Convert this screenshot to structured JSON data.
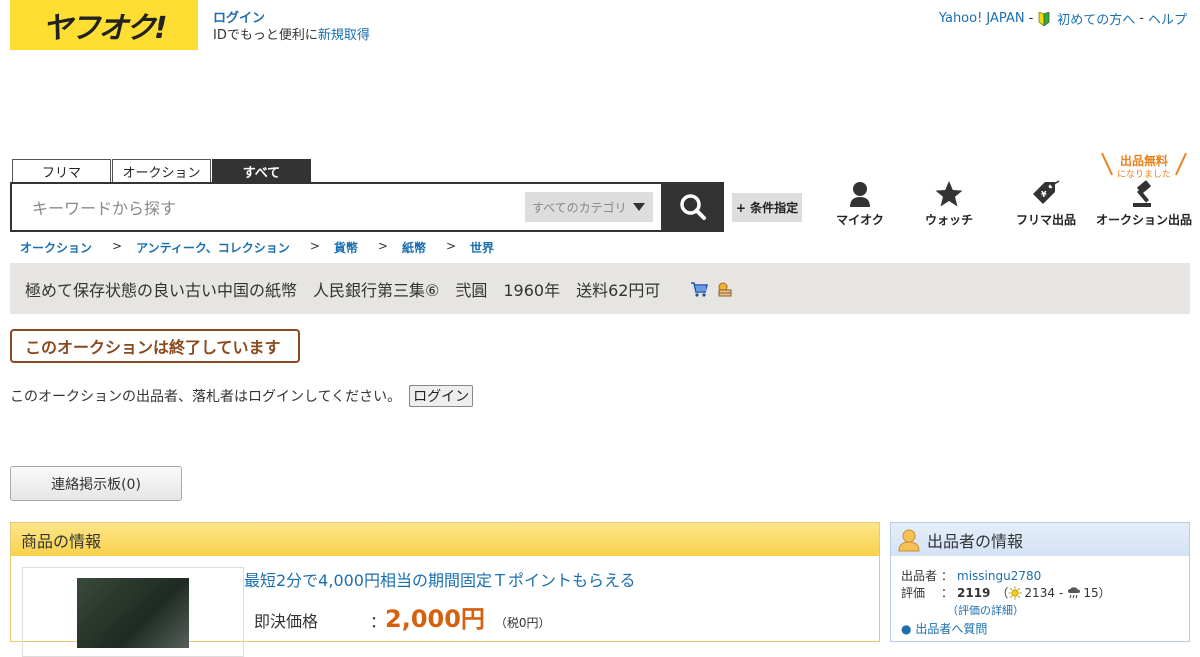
{
  "header": {
    "logo_text": "ヤフオク!",
    "login_link": "ログイン",
    "id_note": "IDでもっと便利に",
    "signup_link": "新規取得",
    "top_links": [
      "Yahoo! JAPAN",
      "初めての方へ",
      "ヘルプ"
    ],
    "sep": "-"
  },
  "search": {
    "tabs": [
      "フリマ",
      "オークション",
      "すべて"
    ],
    "active_tab": "すべて",
    "placeholder": "キーワードから探す",
    "category": "すべてのカテゴリ",
    "cond_button": "+ 条件指定"
  },
  "nav": {
    "myauc": "マイオク",
    "watch": "ウォッチ",
    "flea_listing": "フリマ出品",
    "auction_listing": "オークション出品",
    "free_badge_big": "出品無料",
    "free_badge_small": "になりました"
  },
  "breadcrumb": [
    "オークション",
    "アンティーク、コレクション",
    "貨幣",
    "紙幣",
    "世界"
  ],
  "breadcrumb_sep": ">",
  "item": {
    "title": "極めて保存状態の良い古い中国の紙幣　人民銀行第三集⑥　弐圓　1960年　送料62円可",
    "ended_text": "このオークションは終了しています",
    "login_note": "このオークションの出品者、落札者はログインしてください。",
    "login_button": "ログイン",
    "board_button": "連絡掲示板(0)",
    "info_heading": "商品の情報",
    "promo": "最短2分で4,000円相当の期間固定Ｔポイントもらえる",
    "price_label": "即決価格",
    "colon": "：",
    "price_value": "2,000円",
    "price_tax": "（税0円）"
  },
  "seller": {
    "heading": "出品者の情報",
    "seller_label": "出品者",
    "colon": "：",
    "seller_id": "missingu2780",
    "rating_label": "評価",
    "rating_total": "2119",
    "rating_good": "2134",
    "rating_bad": "15",
    "rating_detail": "（評価の詳細）",
    "question_link": "出品者へ質問"
  },
  "colors": {
    "yellow": "#ffde33",
    "link": "#1a6fb0",
    "price": "#d6600f",
    "ended": "#8b4a1e"
  }
}
